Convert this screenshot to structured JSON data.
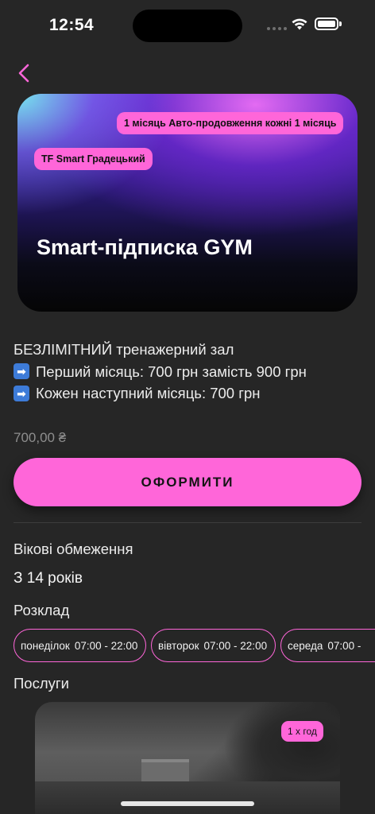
{
  "status_bar": {
    "time": "12:54"
  },
  "card": {
    "renewal_pill": "1 місяць Авто-продовження кожні 1 місяць",
    "club_pill": "TF Smart Градецький",
    "title": "Smart-підписка GYM"
  },
  "description": {
    "line1": "БЕЗЛІМІТНИЙ тренажерний зал",
    "line2": "Перший місяць: 700 грн замість 900 грн",
    "line3": "Кожен наступний місяць: 700 грн",
    "arrow_glyph": "➡"
  },
  "price": "700,00 ₴",
  "cta_label": "ОФОРМИТИ",
  "age": {
    "label": "Вікові обмеження",
    "value": "З 14 років"
  },
  "schedule": {
    "label": "Розклад",
    "days": [
      {
        "day": "понеділок",
        "hours": "07:00 - 22:00"
      },
      {
        "day": "вівторок",
        "hours": "07:00 - 22:00"
      },
      {
        "day": "середа",
        "hours": "07:00 -"
      }
    ]
  },
  "services": {
    "label": "Послуги",
    "badge": "1 х год"
  },
  "colors": {
    "accent": "#ff66d9",
    "background": "#262626"
  }
}
